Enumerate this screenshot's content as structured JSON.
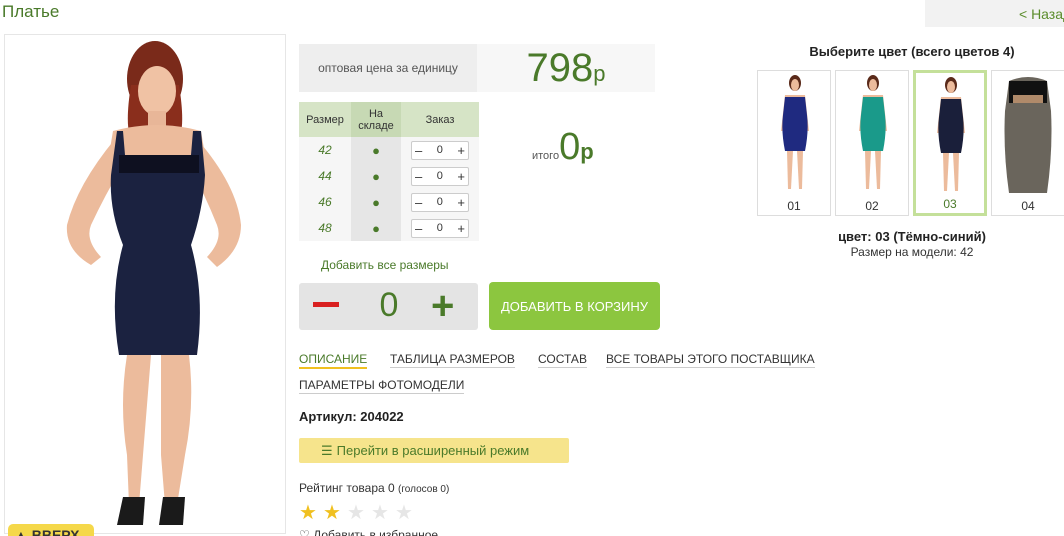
{
  "page": {
    "title": "Платье",
    "back_label": "< Назад"
  },
  "up_button": {
    "label": "▲ ВВЕРХ"
  },
  "price": {
    "label": "оптовая цена за единицу",
    "value": "798",
    "currency": "р"
  },
  "size_table": {
    "headers": [
      "Размер",
      "На складе",
      "Заказ"
    ],
    "rows": [
      {
        "size": "42",
        "stock": "●",
        "qty": "0"
      },
      {
        "size": "44",
        "stock": "●",
        "qty": "0"
      },
      {
        "size": "46",
        "stock": "●",
        "qty": "0"
      },
      {
        "size": "48",
        "stock": "●",
        "qty": "0"
      }
    ],
    "minus": "–",
    "plus": "+"
  },
  "total": {
    "label": "итого",
    "value": "0",
    "currency": "р"
  },
  "add_all_sizes": "Добавить все размеры",
  "quantity": {
    "value": "0",
    "plus": "+"
  },
  "cart_button": "ДОБАВИТЬ В КОРЗИНУ",
  "tabs": [
    "ОПИСАНИЕ",
    "ТАБЛИЦА РАЗМЕРОВ",
    "СОСТАВ",
    "ВСЕ ТОВАРЫ ЭТОГО ПОСТАВЩИКА",
    "ПАРАМЕТРЫ ФОТОМОДЕЛИ"
  ],
  "article": "Артикул: 204022",
  "advanced_mode": {
    "icon": "list-icon",
    "label": "Перейти в расширенный режим"
  },
  "rating": {
    "label": "Рейтинг товара 0",
    "votes": "(голосов 0)",
    "stars_filled": 1.5,
    "stars_total": 5
  },
  "favorite": {
    "icon": "heart-icon",
    "label": "Добавить в избранное"
  },
  "colors": {
    "title": "Выберите цвет (всего цветов 4)",
    "items": [
      {
        "label": "01",
        "color": "#1f2a80"
      },
      {
        "label": "02",
        "color": "#1a9a8a"
      },
      {
        "label": "03",
        "color": "#1a1f3a"
      },
      {
        "label": "04",
        "color": "#6a655c"
      }
    ],
    "selected_index": 2,
    "current": "цвет: 03 (Тёмно-синий)",
    "model_size": "Размер на модели: 42"
  },
  "colors_brand": {
    "green": "#4a7a2a",
    "accent": "#8cc63f",
    "highlight": "#f0c020"
  }
}
